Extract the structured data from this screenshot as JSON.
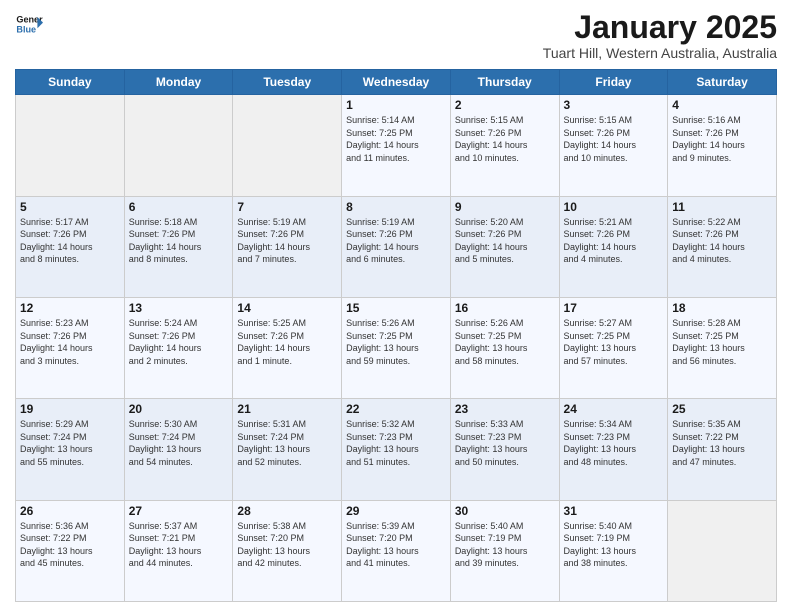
{
  "header": {
    "logo_line1": "General",
    "logo_line2": "Blue",
    "month": "January 2025",
    "location": "Tuart Hill, Western Australia, Australia"
  },
  "weekdays": [
    "Sunday",
    "Monday",
    "Tuesday",
    "Wednesday",
    "Thursday",
    "Friday",
    "Saturday"
  ],
  "weeks": [
    [
      {
        "day": "",
        "info": ""
      },
      {
        "day": "",
        "info": ""
      },
      {
        "day": "",
        "info": ""
      },
      {
        "day": "1",
        "info": "Sunrise: 5:14 AM\nSunset: 7:25 PM\nDaylight: 14 hours\nand 11 minutes."
      },
      {
        "day": "2",
        "info": "Sunrise: 5:15 AM\nSunset: 7:26 PM\nDaylight: 14 hours\nand 10 minutes."
      },
      {
        "day": "3",
        "info": "Sunrise: 5:15 AM\nSunset: 7:26 PM\nDaylight: 14 hours\nand 10 minutes."
      },
      {
        "day": "4",
        "info": "Sunrise: 5:16 AM\nSunset: 7:26 PM\nDaylight: 14 hours\nand 9 minutes."
      }
    ],
    [
      {
        "day": "5",
        "info": "Sunrise: 5:17 AM\nSunset: 7:26 PM\nDaylight: 14 hours\nand 8 minutes."
      },
      {
        "day": "6",
        "info": "Sunrise: 5:18 AM\nSunset: 7:26 PM\nDaylight: 14 hours\nand 8 minutes."
      },
      {
        "day": "7",
        "info": "Sunrise: 5:19 AM\nSunset: 7:26 PM\nDaylight: 14 hours\nand 7 minutes."
      },
      {
        "day": "8",
        "info": "Sunrise: 5:19 AM\nSunset: 7:26 PM\nDaylight: 14 hours\nand 6 minutes."
      },
      {
        "day": "9",
        "info": "Sunrise: 5:20 AM\nSunset: 7:26 PM\nDaylight: 14 hours\nand 5 minutes."
      },
      {
        "day": "10",
        "info": "Sunrise: 5:21 AM\nSunset: 7:26 PM\nDaylight: 14 hours\nand 4 minutes."
      },
      {
        "day": "11",
        "info": "Sunrise: 5:22 AM\nSunset: 7:26 PM\nDaylight: 14 hours\nand 4 minutes."
      }
    ],
    [
      {
        "day": "12",
        "info": "Sunrise: 5:23 AM\nSunset: 7:26 PM\nDaylight: 14 hours\nand 3 minutes."
      },
      {
        "day": "13",
        "info": "Sunrise: 5:24 AM\nSunset: 7:26 PM\nDaylight: 14 hours\nand 2 minutes."
      },
      {
        "day": "14",
        "info": "Sunrise: 5:25 AM\nSunset: 7:26 PM\nDaylight: 14 hours\nand 1 minute."
      },
      {
        "day": "15",
        "info": "Sunrise: 5:26 AM\nSunset: 7:25 PM\nDaylight: 13 hours\nand 59 minutes."
      },
      {
        "day": "16",
        "info": "Sunrise: 5:26 AM\nSunset: 7:25 PM\nDaylight: 13 hours\nand 58 minutes."
      },
      {
        "day": "17",
        "info": "Sunrise: 5:27 AM\nSunset: 7:25 PM\nDaylight: 13 hours\nand 57 minutes."
      },
      {
        "day": "18",
        "info": "Sunrise: 5:28 AM\nSunset: 7:25 PM\nDaylight: 13 hours\nand 56 minutes."
      }
    ],
    [
      {
        "day": "19",
        "info": "Sunrise: 5:29 AM\nSunset: 7:24 PM\nDaylight: 13 hours\nand 55 minutes."
      },
      {
        "day": "20",
        "info": "Sunrise: 5:30 AM\nSunset: 7:24 PM\nDaylight: 13 hours\nand 54 minutes."
      },
      {
        "day": "21",
        "info": "Sunrise: 5:31 AM\nSunset: 7:24 PM\nDaylight: 13 hours\nand 52 minutes."
      },
      {
        "day": "22",
        "info": "Sunrise: 5:32 AM\nSunset: 7:23 PM\nDaylight: 13 hours\nand 51 minutes."
      },
      {
        "day": "23",
        "info": "Sunrise: 5:33 AM\nSunset: 7:23 PM\nDaylight: 13 hours\nand 50 minutes."
      },
      {
        "day": "24",
        "info": "Sunrise: 5:34 AM\nSunset: 7:23 PM\nDaylight: 13 hours\nand 48 minutes."
      },
      {
        "day": "25",
        "info": "Sunrise: 5:35 AM\nSunset: 7:22 PM\nDaylight: 13 hours\nand 47 minutes."
      }
    ],
    [
      {
        "day": "26",
        "info": "Sunrise: 5:36 AM\nSunset: 7:22 PM\nDaylight: 13 hours\nand 45 minutes."
      },
      {
        "day": "27",
        "info": "Sunrise: 5:37 AM\nSunset: 7:21 PM\nDaylight: 13 hours\nand 44 minutes."
      },
      {
        "day": "28",
        "info": "Sunrise: 5:38 AM\nSunset: 7:20 PM\nDaylight: 13 hours\nand 42 minutes."
      },
      {
        "day": "29",
        "info": "Sunrise: 5:39 AM\nSunset: 7:20 PM\nDaylight: 13 hours\nand 41 minutes."
      },
      {
        "day": "30",
        "info": "Sunrise: 5:40 AM\nSunset: 7:19 PM\nDaylight: 13 hours\nand 39 minutes."
      },
      {
        "day": "31",
        "info": "Sunrise: 5:40 AM\nSunset: 7:19 PM\nDaylight: 13 hours\nand 38 minutes."
      },
      {
        "day": "",
        "info": ""
      }
    ]
  ]
}
